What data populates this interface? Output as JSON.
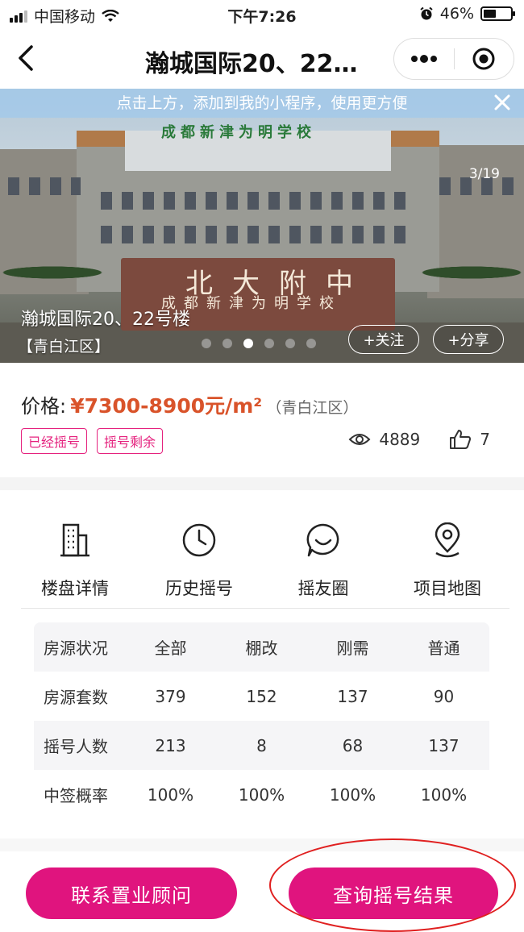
{
  "status_bar": {
    "carrier": "中国移动",
    "time": "下午7:26",
    "battery": "46%",
    "battery_level": 0.46
  },
  "nav": {
    "title": "瀚城国际20、22…",
    "back_icon": "chevron-left-icon",
    "more_icon": "more-dots-icon",
    "close_icon": "target-circle-icon"
  },
  "hero": {
    "banner_text": "点击上方，添加到我的小程序，使用更方便",
    "sign_text": "成都新津为明学校",
    "stone_text_large": "北大附中",
    "stone_text_small": "成都新津为明学校",
    "counter": "3/19",
    "name": "瀚城国际20、22号楼",
    "district": "【青白江区】",
    "follow_label": "+关注",
    "share_label": "+分享",
    "dots_total": 6,
    "dot_active_index": 2
  },
  "price": {
    "label": "价格:",
    "value": "¥7300-8900元/m²",
    "district": "（青白江区）",
    "tags": [
      "已经摇号",
      "摇号剩余"
    ],
    "views": "4889",
    "likes": "7"
  },
  "menu": [
    {
      "label": "楼盘详情",
      "icon": "building-icon"
    },
    {
      "label": "历史摇号",
      "icon": "clock-icon"
    },
    {
      "label": "摇友圈",
      "icon": "chat-bubble-icon"
    },
    {
      "label": "项目地图",
      "icon": "map-pin-icon"
    }
  ],
  "table": {
    "header": [
      "房源状况",
      "全部",
      "棚改",
      "刚需",
      "普通"
    ],
    "rows": [
      [
        "房源套数",
        "379",
        "152",
        "137",
        "90"
      ],
      [
        "摇号人数",
        "213",
        "8",
        "68",
        "137"
      ],
      [
        "中签概率",
        "100%",
        "100%",
        "100%",
        "100%"
      ]
    ]
  },
  "actions": {
    "contact_label": "联系置业顾问",
    "query_label": "查询摇号结果"
  },
  "colors": {
    "accent": "#e0147e",
    "price": "#d9532a",
    "annotation": "#e02020"
  }
}
